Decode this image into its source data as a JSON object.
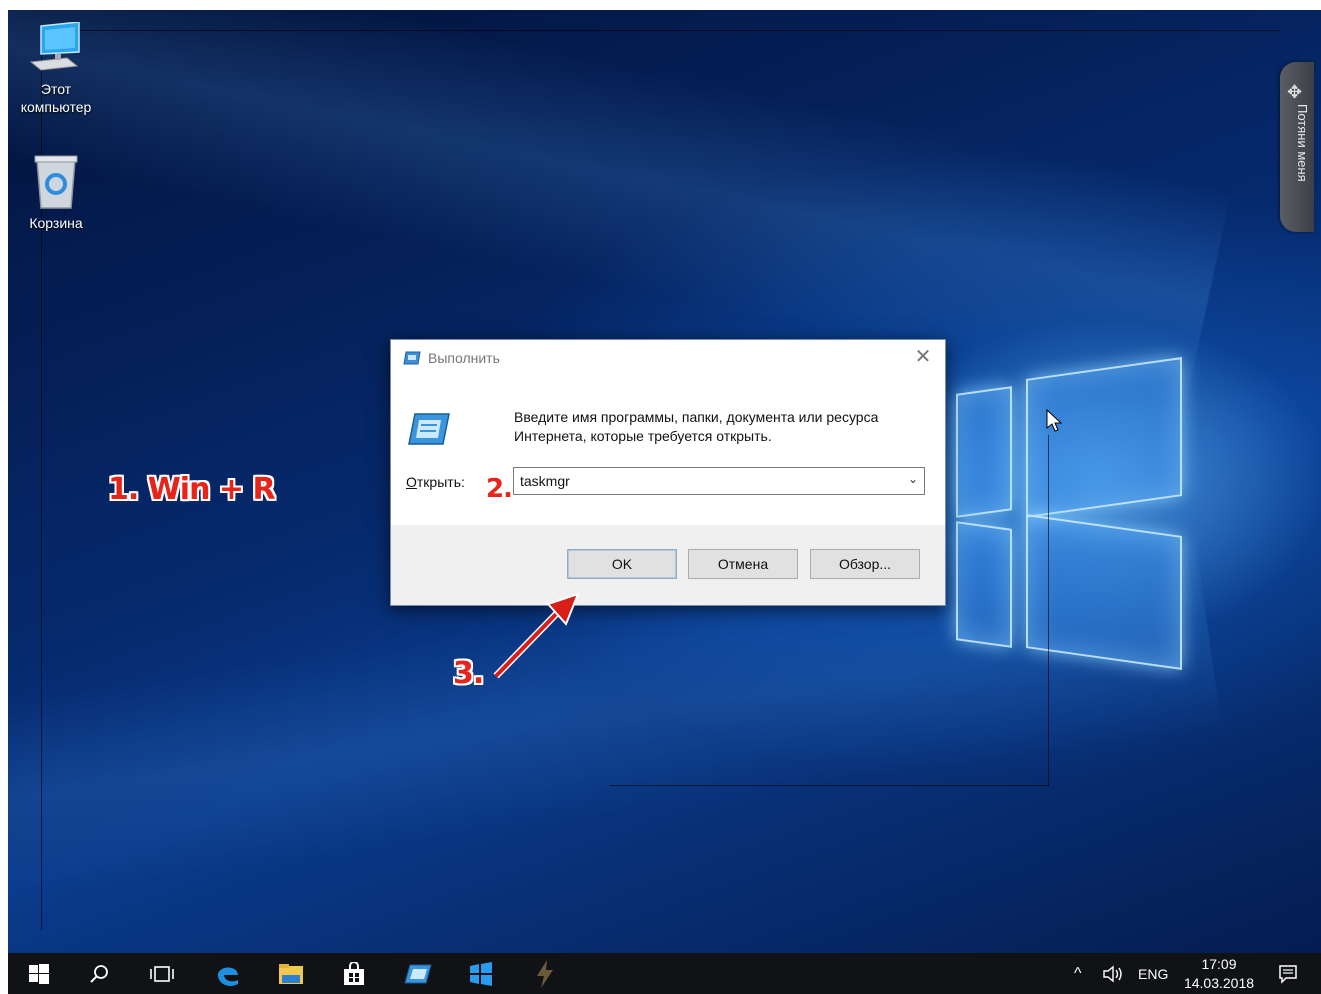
{
  "desktop": {
    "icons": [
      {
        "label_line1": "Этот",
        "label_line2": "компьютер",
        "icon": "computer-icon"
      },
      {
        "label": "Корзина",
        "icon": "recycle-bin-icon"
      }
    ],
    "side_panel": {
      "label": "Потяни меня",
      "icon": "move-icon"
    }
  },
  "run_dialog": {
    "title": "Выполнить",
    "description": "Введите имя программы, папки, документа или ресурса Интернета, которые требуется открыть.",
    "open_label_underlined": "О",
    "open_label_rest": "ткрыть:",
    "command_value": "taskmgr",
    "buttons": {
      "ok": "OK",
      "cancel": "Отмена",
      "browse": "Обзор..."
    }
  },
  "annotations": {
    "step1": "1. Win + R",
    "step2": "2.",
    "step3": "3.",
    "color": "#e8231a"
  },
  "taskbar": {
    "tray": {
      "language": "ENG",
      "time": "17:09",
      "date": "14.03.2018"
    },
    "apps": [
      "start-icon",
      "search-icon",
      "task-view-icon",
      "edge-icon",
      "file-explorer-icon",
      "store-icon",
      "run-icon",
      "windows-app-icon",
      "lightning-app-icon"
    ]
  }
}
